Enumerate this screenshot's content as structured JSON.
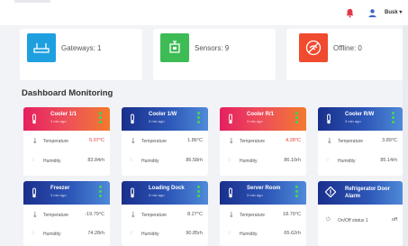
{
  "header": {
    "user_name": "Busk",
    "icons": [
      "bell-icon",
      "user-icon"
    ]
  },
  "stats": [
    {
      "label": "Gateways: 1",
      "color": "#1ea0e0",
      "icon": "router-icon"
    },
    {
      "label": "Sensors: 9",
      "color": "#3dbb55",
      "icon": "sensor-icon"
    },
    {
      "label": "Offline: 0",
      "color": "#f04a2f",
      "icon": "wifi-off-icon"
    }
  ],
  "section_title": "Dashboard Monitoring",
  "cards": [
    {
      "title": "Cooler 1/1",
      "sub": "3 min ago",
      "theme": "warn",
      "temp_label": "Temperature",
      "temp_value": "5.07°C",
      "temp_alert": true,
      "hum_label": "Humidity",
      "hum_value": "83.84rh"
    },
    {
      "title": "Cooler 1/W",
      "sub": "3 min ago",
      "theme": "cool",
      "temp_label": "Temperature",
      "temp_value": "1.86°C",
      "temp_alert": false,
      "hum_label": "Humidity",
      "hum_value": "86.58rh"
    },
    {
      "title": "Cooler R/1",
      "sub": "3 min ago",
      "theme": "warn",
      "temp_label": "Temperature",
      "temp_value": "4.28°C",
      "temp_alert": true,
      "hum_label": "Humidity",
      "hum_value": "86.10rh"
    },
    {
      "title": "Cooler R/W",
      "sub": "3 min ago",
      "theme": "cool",
      "temp_label": "Temperature",
      "temp_value": "3.89°C",
      "temp_alert": false,
      "hum_label": "Humidity",
      "hum_value": "85.14rh"
    },
    {
      "title": "Freezer",
      "sub": "3 min ago",
      "theme": "cool",
      "temp_label": "Temperature",
      "temp_value": "-19.79°C",
      "temp_alert": false,
      "hum_label": "Humidity",
      "hum_value": "74.28rh"
    },
    {
      "title": "Loading Dock",
      "sub": "3 min ago",
      "theme": "cool",
      "temp_label": "Temperature",
      "temp_value": "8.27°C",
      "temp_alert": false,
      "hum_label": "Humidity",
      "hum_value": "90.85rh"
    },
    {
      "title": "Server Room",
      "sub": "3 min ago",
      "theme": "cool",
      "temp_label": "Temperature",
      "temp_value": "18.79°C",
      "temp_alert": false,
      "hum_label": "Humidity",
      "hum_value": "65.62rh"
    }
  ],
  "alarm_card": {
    "title": "Refrigerator Door Alarm",
    "row_label": "On/Off status 1",
    "row_value": "off"
  }
}
